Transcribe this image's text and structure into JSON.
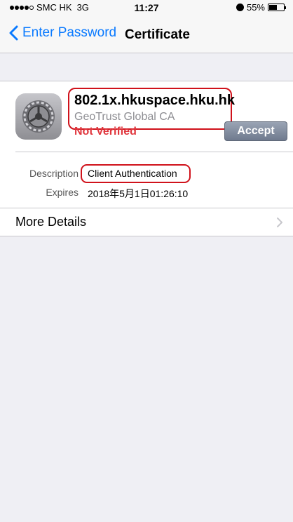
{
  "status_bar": {
    "carrier": "SMC HK",
    "network": "3G",
    "time": "11:27",
    "battery": "55%",
    "battery_level": 0.55
  },
  "nav": {
    "back_label": "Enter Password",
    "title": "Certificate"
  },
  "certificate": {
    "name": "802.1x.hkuspace.hku.hk",
    "issuer": "GeoTrust Global CA",
    "status": "Not Verified",
    "accept_label": "Accept"
  },
  "details": {
    "description_label": "Description",
    "description_value": "Client Authentication",
    "expires_label": "Expires",
    "expires_value": "2018年5月1日01:26:10"
  },
  "more_details": {
    "label": "More Details"
  },
  "colors": {
    "accent": "#0a7aff",
    "warning": "#e0363d",
    "highlight": "#d0121b"
  }
}
